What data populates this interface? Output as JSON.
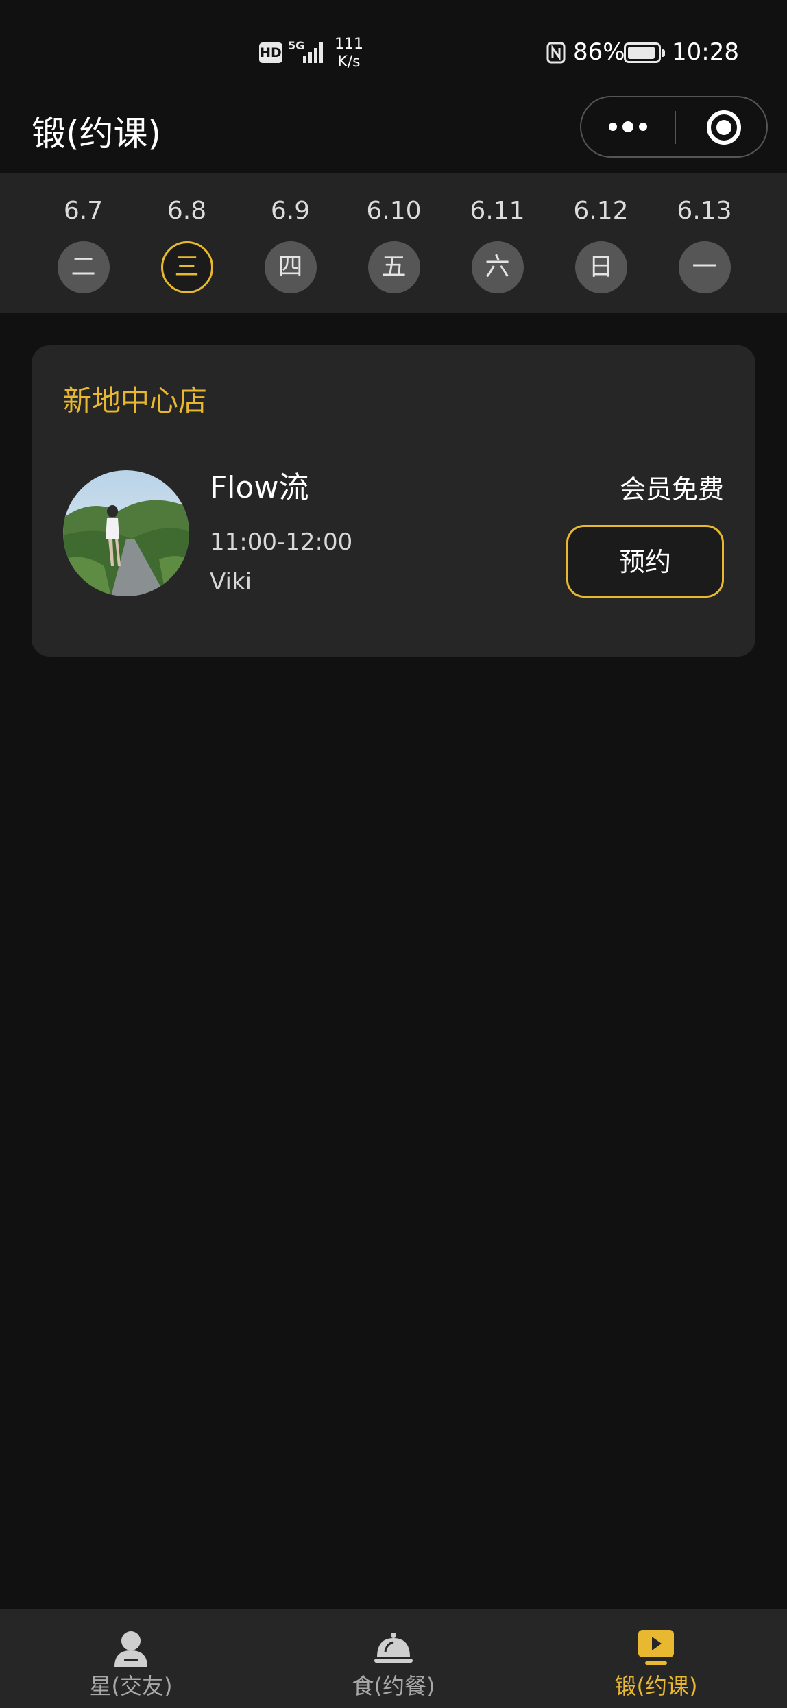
{
  "status_bar": {
    "hd": "HD",
    "network": "5G",
    "speed_value": "111",
    "speed_unit": "K/s",
    "battery": "86%",
    "time": "10:28"
  },
  "nav": {
    "title": "锻(约课)"
  },
  "dates": [
    {
      "date": "6.7",
      "weekday": "二",
      "selected": false
    },
    {
      "date": "6.8",
      "weekday": "三",
      "selected": true
    },
    {
      "date": "6.9",
      "weekday": "四",
      "selected": false
    },
    {
      "date": "6.10",
      "weekday": "五",
      "selected": false
    },
    {
      "date": "6.11",
      "weekday": "六",
      "selected": false
    },
    {
      "date": "6.12",
      "weekday": "日",
      "selected": false
    },
    {
      "date": "6.13",
      "weekday": "一",
      "selected": false
    }
  ],
  "store": {
    "name": "新地中心店",
    "classes": [
      {
        "name": "Flow流",
        "time": "11:00-12:00",
        "coach": "Viki",
        "price": "会员免费",
        "book_label": "预约"
      }
    ]
  },
  "tabs": [
    {
      "label": "星(交友)",
      "icon": "person-icon",
      "active": false
    },
    {
      "label": "食(约餐)",
      "icon": "food-cloche-icon",
      "active": false
    },
    {
      "label": "锻(约课)",
      "icon": "video-play-icon",
      "active": true
    }
  ],
  "colors": {
    "background": "#111111",
    "accent": "#e8b830",
    "card": "#262626",
    "strip": "#242424",
    "inactive_tab": "#a8a8a8"
  }
}
